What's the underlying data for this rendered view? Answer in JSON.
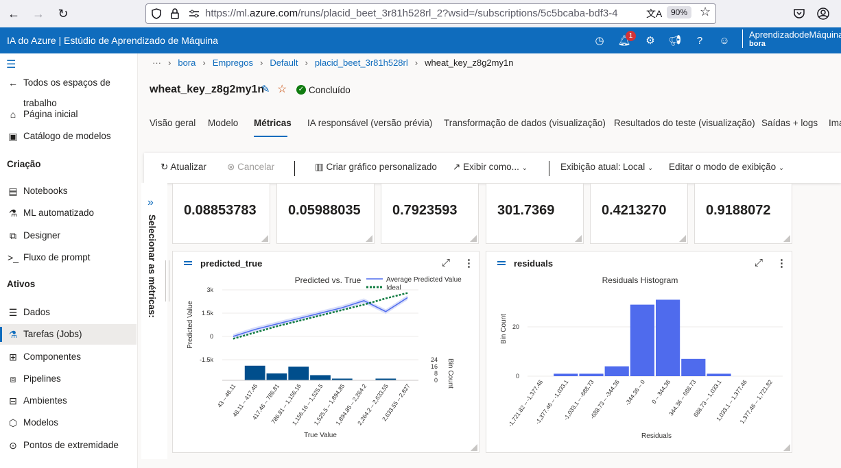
{
  "browser": {
    "url_prefix": "https://ml.",
    "url_host": "azure.com",
    "url_rest": "/runs/placid_beet_3r81h528rl_2?wsid=/subscriptions/5c5bcaba-bdf3-4",
    "zoom": "90%"
  },
  "header": {
    "title": "IA do Azure | Estúdio de Aprendizado de Máquina",
    "notifications_count": "1",
    "workspace": "AprendizadodeMáquina",
    "user": "bora"
  },
  "sidebar": {
    "back_label": "Todos os espaços de trabalho",
    "items_top": [
      {
        "label": "Página inicial",
        "icon": "home-icon"
      },
      {
        "label": "Catálogo de modelos",
        "icon": "catalog-icon"
      }
    ],
    "group_creation": "Criação",
    "items_creation": [
      {
        "label": "Notebooks",
        "icon": "notebook-icon"
      },
      {
        "label": "ML automatizado",
        "icon": "automl-icon"
      },
      {
        "label": "Designer",
        "icon": "designer-icon"
      },
      {
        "label": "Fluxo de prompt",
        "icon": "prompt-flow-icon"
      }
    ],
    "group_assets": "Ativos",
    "items_assets": [
      {
        "label": "Dados",
        "icon": "data-icon"
      },
      {
        "label": "Tarefas (Jobs)",
        "icon": "jobs-icon"
      },
      {
        "label": "Componentes",
        "icon": "components-icon"
      },
      {
        "label": "Pipelines",
        "icon": "pipelines-icon"
      },
      {
        "label": "Ambientes",
        "icon": "environments-icon"
      },
      {
        "label": "Modelos",
        "icon": "models-icon"
      },
      {
        "label": "Pontos de extremidade",
        "icon": "endpoints-icon"
      }
    ]
  },
  "breadcrumb": {
    "more": "···",
    "items": [
      "bora",
      "Empregos",
      "Default",
      "placid_beet_3r81h528rl"
    ],
    "current": "wheat_key_z8g2my1n"
  },
  "job": {
    "name": "wheat_key_z8g2my1n",
    "status": "Concluído",
    "status_color": "#107c10"
  },
  "tabs": [
    "Visão geral",
    "Modelo",
    "Métricas",
    "IA responsável (versão prévia)",
    "Transformação de dados (visualização)",
    "Resultados do teste (visualização)",
    "Saídas + logs",
    "Ima"
  ],
  "toolbar": {
    "refresh": "Atualizar",
    "cancel": "Cancelar",
    "custom_chart": "Criar gráfico personalizado",
    "view_as": "Exibir como...",
    "current_view_label": "Exibição atual:",
    "current_view_value": "Local",
    "edit_view": "Editar o modo de exibição"
  },
  "metrics_panel": {
    "label": "Selecionar as métricas:"
  },
  "metric_values": [
    "0.08853783",
    "0.05988035",
    "0.7923593",
    "301.7369",
    "0.4213270",
    "0.9188072"
  ],
  "charts": {
    "predicted_true": {
      "card_title": "predicted_true"
    },
    "residuals": {
      "card_title": "residuals"
    }
  },
  "chart_data": [
    {
      "type": "line",
      "title": "Predicted vs. True",
      "xlabel": "True Value",
      "ylabel": "Predicted Value",
      "y2label": "Bin Count",
      "categories": [
        "43 – 48.11",
        "48.11 – 417.46",
        "417.46 – 786.81",
        "786.81 – 1,156.16",
        "1,156.16 – 1,525.5",
        "1,525.5 – 1,894.85",
        "1,894.85 – 2,264.2",
        "2,264.2 – 2,633.55",
        "2,633.55 – 2,827"
      ],
      "ylim": [
        -1500,
        3000
      ],
      "yticks": [
        "3k",
        "1.5k",
        "0",
        "-1.5k"
      ],
      "y2ticks": [
        "24",
        "16",
        "8",
        "0"
      ],
      "series": [
        {
          "name": "Average Predicted Value",
          "values": [
            0,
            450,
            800,
            1150,
            1500,
            1850,
            2300,
            1600,
            2500
          ],
          "color": "#4f6bed"
        },
        {
          "name": "Ideal",
          "values": [
            -150,
            250,
            650,
            1000,
            1350,
            1700,
            2050,
            2450,
            2800
          ],
          "color": "#107c41"
        }
      ],
      "bin_counts": [
        0,
        17,
        8,
        16,
        6,
        2,
        0,
        2,
        0
      ],
      "bar_color": "#004e8c"
    },
    {
      "type": "bar",
      "title": "Residuals Histogram",
      "xlabel": "Residuals",
      "ylabel": "Bin Count",
      "categories": [
        "-1,721.82 – -1,377.46",
        "-1,377.46 – -1,033.1",
        "-1,033.1 – -688.73",
        "-688.73 – -344.36",
        "-344.36 – 0",
        "0 – 344.36",
        "344.36 – 688.73",
        "688.73 – 1,033.1",
        "1,033.1 – 1,377.46",
        "1,377.46 – 1,721.82"
      ],
      "values": [
        0,
        1,
        1,
        4,
        29,
        31,
        7,
        1,
        0,
        0
      ],
      "ylim": [
        0,
        35
      ],
      "yticks": [
        "20",
        "0"
      ],
      "color": "#4f6bed"
    }
  ]
}
